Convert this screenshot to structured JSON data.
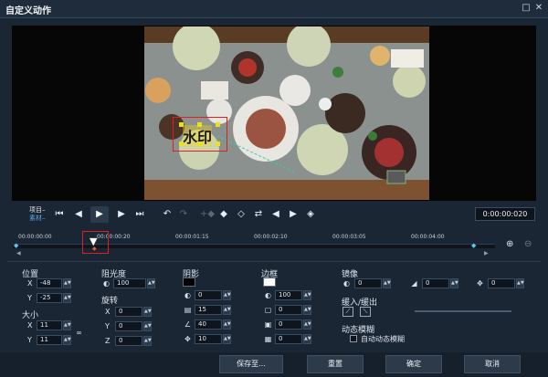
{
  "window": {
    "title": "自定义动作"
  },
  "viewer": {
    "watermark_text": "水印"
  },
  "transport": {
    "project_label": "项目–",
    "clip_label": "素材–",
    "timecode": "0:00:00:020"
  },
  "timeline": {
    "ticks": [
      "00:00:00:00",
      "00:00:00:20",
      "00:00:01:15",
      "00:00:02:10",
      "00:00:03:05",
      "00:00:04:00"
    ]
  },
  "position": {
    "title": "位置",
    "x_label": "X",
    "x_value": "-48",
    "y_label": "Y",
    "y_value": "-25"
  },
  "size": {
    "title": "大小",
    "x_label": "X",
    "x_value": "11",
    "y_label": "Y",
    "y_value": "11"
  },
  "opacity": {
    "title": "阻光度",
    "value": "100"
  },
  "rotation": {
    "title": "旋转",
    "x_label": "X",
    "x_value": "0",
    "y_label": "Y",
    "y_value": "0",
    "z_label": "Z",
    "z_value": "0"
  },
  "shadow": {
    "title": "阴影",
    "v1": "0",
    "v2": "15",
    "v3": "40",
    "v4": "10",
    "color": "#000000"
  },
  "border": {
    "title": "边框",
    "v1": "100",
    "v2": "0",
    "v3": "0",
    "v4": "0",
    "color": "#ffffff"
  },
  "mirror": {
    "title": "镜像",
    "v1": "0",
    "v2": "0",
    "v3": "0"
  },
  "ease": {
    "title": "缓入/缓出"
  },
  "motion_blur": {
    "title": "动态模糊",
    "checkbox_label": "自动动态模糊"
  },
  "footer": {
    "save_as": "保存至...",
    "reset": "重置",
    "ok": "确定",
    "cancel": "取消"
  }
}
